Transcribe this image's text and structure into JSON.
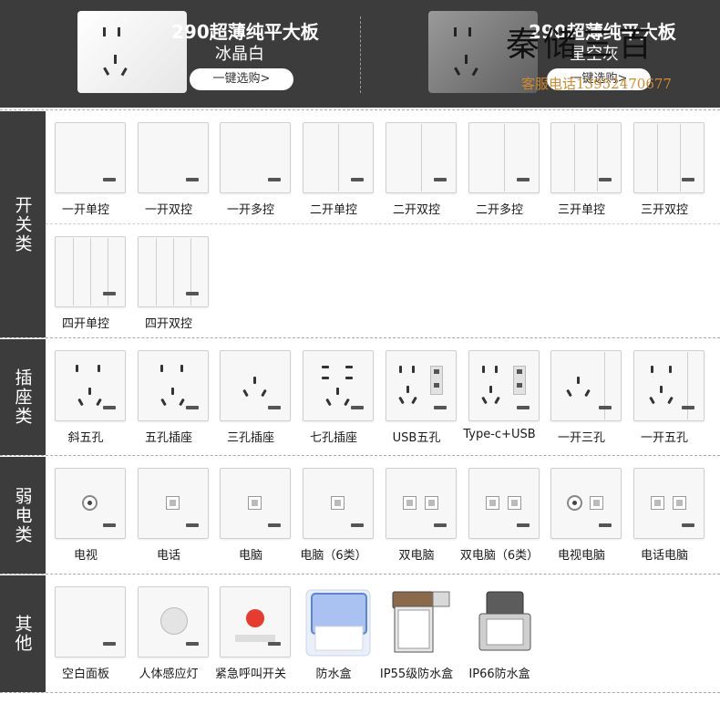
{
  "header": {
    "left": {
      "title": "290超薄纯平大板",
      "subtitle": "冰晶白",
      "button": "一键选购>"
    },
    "right": {
      "title": "290超薄纯平大板",
      "subtitle": "星空灰",
      "button": "一键选购>"
    },
    "watermark_brand": "秦储三百",
    "watermark_phone": "客服电话13952470677"
  },
  "sections": {
    "switch": {
      "label": "开关类",
      "items": [
        "一开单控",
        "一开双控",
        "一开多控",
        "二开单控",
        "二开双控",
        "二开多控",
        "三开单控",
        "三开双控",
        "四开单控",
        "四开双控"
      ]
    },
    "socket": {
      "label": "插座类",
      "items": [
        "斜五孔",
        "五孔插座",
        "三孔插座",
        "七孔插座",
        "USB五孔",
        "Type-c+USB",
        "一开三孔",
        "一开五孔"
      ]
    },
    "weak": {
      "label": "弱电类",
      "items": [
        "电视",
        "电话",
        "电脑",
        "电脑（6类）",
        "双电脑",
        "双电脑（6类）",
        "电视电脑",
        "电话电脑"
      ]
    },
    "other": {
      "label": "其他",
      "items": [
        "空白面板",
        "人体感应灯",
        "紧急呼叫开关",
        "防水盒",
        "IP55级防水盒",
        "IP66防水盒"
      ]
    }
  }
}
